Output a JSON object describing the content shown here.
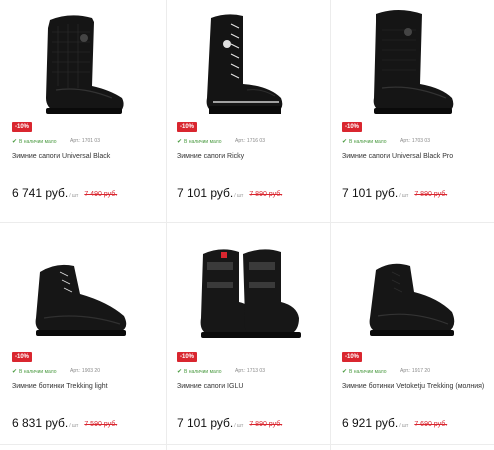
{
  "colors": {
    "discount": "#d9262f",
    "in_stock": "#4a9a40"
  },
  "products": [
    {
      "discount": "-10%",
      "stock": "В наличии мало",
      "article": "Арт.: 1701 03",
      "name": "Зимние сапоги Universal Black",
      "price": "6 741 руб.",
      "unit": "/ шт",
      "old_price": "7 490 руб.",
      "icon": "check-icon"
    },
    {
      "discount": "-10%",
      "stock": "В наличии мало",
      "article": "Арт.: 1716 03",
      "name": "Зимние сапоги Ricky",
      "price": "7 101 руб.",
      "unit": "/ шт",
      "old_price": "7 890 руб.",
      "icon": "check-icon"
    },
    {
      "discount": "-10%",
      "stock": "В наличии мало",
      "article": "Арт.: 1703 03",
      "name": "Зимние сапоги Universal Black Pro",
      "price": "7 101 руб.",
      "unit": "/ шт",
      "old_price": "7 890 руб.",
      "icon": "check-icon"
    },
    {
      "discount": "-10%",
      "stock": "В наличии мало",
      "article": "Арт.: 1903 20",
      "name": "Зимние ботинки Trekking light",
      "price": "6 831 руб.",
      "unit": "/ шт",
      "old_price": "7 590 руб.",
      "icon": "check-icon"
    },
    {
      "discount": "-10%",
      "stock": "В наличии мало",
      "article": "Арт.: 1713 03",
      "name": "Зимние сапоги IGLU",
      "price": "7 101 руб.",
      "unit": "/ шт",
      "old_price": "7 890 руб.",
      "icon": "check-icon"
    },
    {
      "discount": "-10%",
      "stock": "В наличии мало",
      "article": "Арт.: 1917 20",
      "name": "Зимние ботинки Vetoketju Trekking (молния)",
      "price": "6 921 руб.",
      "unit": "/ шт",
      "old_price": "7 690 руб.",
      "icon": "check-icon"
    }
  ]
}
